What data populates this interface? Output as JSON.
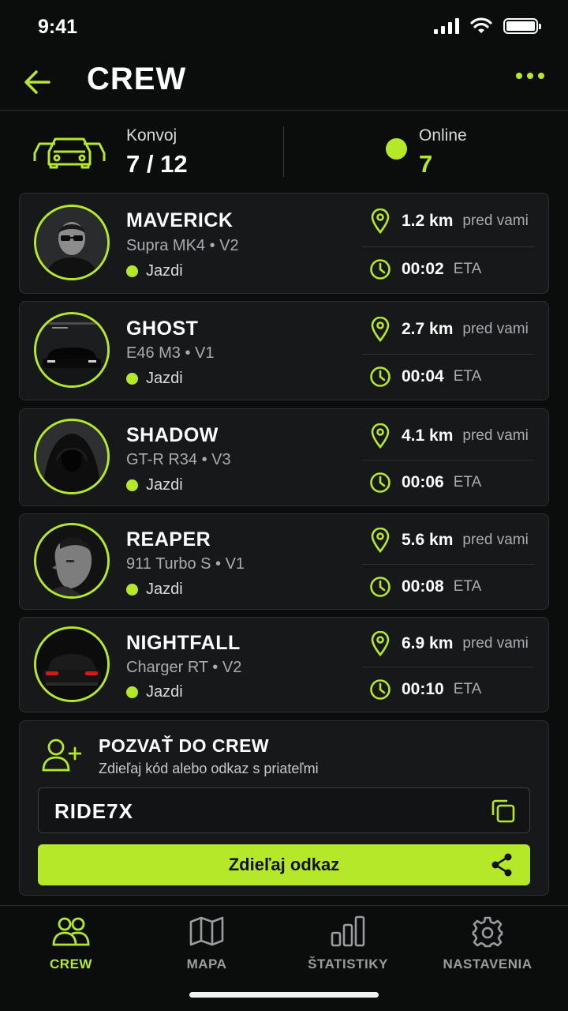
{
  "status_bar": {
    "time": "9:41"
  },
  "header": {
    "title": "CREW",
    "back_icon": "arrow-left-icon",
    "more_icon": "more-dots-icon"
  },
  "summary": {
    "convoy_label": "Konvoj",
    "convoy_count": "7 / 12",
    "online_label": "Online",
    "online_count": "7"
  },
  "members": [
    {
      "name": "MAVERICK",
      "car": "Supra MK4 • V2",
      "status": "Jazdi",
      "distance": "1.2 km",
      "distance_suffix": "pred vami",
      "eta": "00:02",
      "eta_suffix": "ETA"
    },
    {
      "name": "GHOST",
      "car": "E46 M3 • V1",
      "status": "Jazdi",
      "distance": "2.7 km",
      "distance_suffix": "pred vami",
      "eta": "00:04",
      "eta_suffix": "ETA"
    },
    {
      "name": "SHADOW",
      "car": "GT-R R34 • V3",
      "status": "Jazdi",
      "distance": "4.1 km",
      "distance_suffix": "pred vami",
      "eta": "00:06",
      "eta_suffix": "ETA"
    },
    {
      "name": "REAPER",
      "car": "911 Turbo S • V1",
      "status": "Jazdi",
      "distance": "5.6 km",
      "distance_suffix": "pred vami",
      "eta": "00:08",
      "eta_suffix": "ETA"
    },
    {
      "name": "NIGHTFALL",
      "car": "Charger RT • V2",
      "status": "Jazdi",
      "distance": "6.9 km",
      "distance_suffix": "pred vami",
      "eta": "00:10",
      "eta_suffix": "ETA"
    }
  ],
  "invite": {
    "title": "POZVAŤ DO CREW",
    "subtitle": "Zdieľaj kód alebo odkaz s priateľmi",
    "code": "RIDE7X",
    "share_label": "Zdieľaj odkaz"
  },
  "nav": [
    {
      "label": "CREW",
      "icon": "users-icon",
      "active": true
    },
    {
      "label": "MAPA",
      "icon": "map-icon",
      "active": false
    },
    {
      "label": "ŠTATISTIKY",
      "icon": "bar-chart-icon",
      "active": false
    },
    {
      "label": "NASTAVENIA",
      "icon": "gear-icon",
      "active": false
    }
  ],
  "colors": {
    "accent": "#b6e82a",
    "background": "#0b0c0c",
    "card": "#171819"
  }
}
